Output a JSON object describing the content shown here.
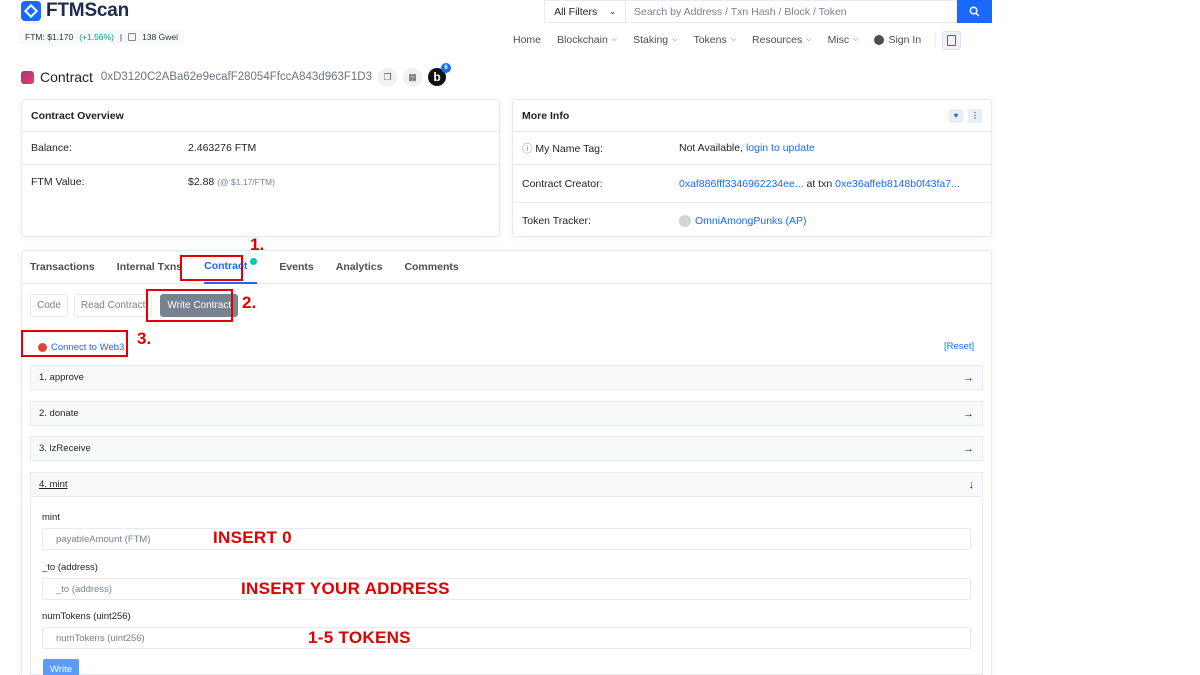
{
  "header": {
    "brand": "FTMScan",
    "price_label": "FTM: $1.170",
    "price_change": "(+1.56%)",
    "separator": "|",
    "gas": "138 Gwei",
    "filter_label": "All Filters",
    "search_placeholder": "Search by Address / Txn Hash / Block / Token",
    "nav": [
      {
        "label": "Home"
      },
      {
        "label": "Blockchain"
      },
      {
        "label": "Staking"
      },
      {
        "label": "Tokens"
      },
      {
        "label": "Resources"
      },
      {
        "label": "Misc"
      },
      {
        "label": "Sign In"
      }
    ]
  },
  "page": {
    "title": "Contract",
    "address": "0xD3120C2ABa62e9ecafF28054FfccA843d963F1D3",
    "badge_letter": "b",
    "badge_count": "6"
  },
  "overview": {
    "title": "Contract Overview",
    "balance_label": "Balance:",
    "balance_value": "2.463276 FTM",
    "value_label": "FTM Value:",
    "value_value": "$2.88",
    "value_note": "(@ $1.17/FTM)"
  },
  "more_info": {
    "title": "More Info",
    "name_tag_label": "My Name Tag:",
    "name_tag_value": "Not Available,",
    "name_tag_link": "login to update",
    "creator_label": "Contract Creator:",
    "creator_address": "0xaf886fff3346962234ee...",
    "creator_at": "at txn",
    "creator_txn": "0xe36affeb8148b0f43fa7...",
    "tracker_label": "Token Tracker:",
    "tracker_value": "OmniAmongPunks (AP)"
  },
  "tabs": [
    {
      "label": "Transactions"
    },
    {
      "label": "Internal Txns"
    },
    {
      "label": "Contract"
    },
    {
      "label": "Events"
    },
    {
      "label": "Analytics"
    },
    {
      "label": "Comments"
    }
  ],
  "subtabs": [
    {
      "label": "Code"
    },
    {
      "label": "Read Contract"
    },
    {
      "label": "Write Contract"
    }
  ],
  "write": {
    "connect_label": "Connect to Web3",
    "reset_label": "[Reset]",
    "functions": [
      {
        "label": "1. approve"
      },
      {
        "label": "2. donate"
      },
      {
        "label": "3. lzReceive"
      },
      {
        "label": "4. mint"
      }
    ],
    "mint": {
      "payable_label": "mint",
      "payable_placeholder": "payableAmount (FTM)",
      "to_label": "_to (address)",
      "to_placeholder": "_to (address)",
      "num_label": "numTokens (uint256)",
      "num_placeholder": "numTokens (uint256)",
      "write_label": "Write"
    }
  },
  "annotations": {
    "step1": "1.",
    "step2": "2.",
    "step3": "3.",
    "note_payable": "INSERT 0",
    "note_address": "INSERT YOUR ADDRESS",
    "note_tokens": "1-5 TOKENS",
    "color": "#e00000"
  },
  "colors": {
    "accent": "#1969ff",
    "success": "#00a186",
    "text_muted": "#77838f"
  }
}
